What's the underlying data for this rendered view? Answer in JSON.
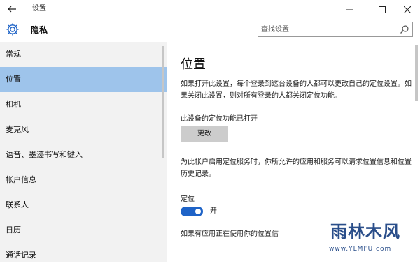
{
  "titlebar": {
    "back_icon": "back-arrow-icon",
    "title": "设置",
    "minimize_icon": "minimize-icon",
    "maximize_icon": "maximize-icon",
    "close_icon": "close-icon"
  },
  "header": {
    "icon": "gear-icon",
    "title": "隐私",
    "search": {
      "placeholder": "查找设置",
      "icon": "search-icon"
    }
  },
  "sidebar": {
    "active_color": "#9ec4eb",
    "items": [
      {
        "label": "常规",
        "active": false
      },
      {
        "label": "位置",
        "active": true
      },
      {
        "label": "相机",
        "active": false
      },
      {
        "label": "麦克风",
        "active": false
      },
      {
        "label": "语音、墨迹书写和键入",
        "active": false
      },
      {
        "label": "帐户信息",
        "active": false
      },
      {
        "label": "联系人",
        "active": false
      },
      {
        "label": "日历",
        "active": false
      },
      {
        "label": "通话记录",
        "active": false
      }
    ]
  },
  "content": {
    "title": "位置",
    "intro": "如果打开此设置，每个登录到这台设备的人都可以更改自己的定位设置。如果关闭此设置，则对所有登录的人都关闭定位功能。",
    "device_status": "此设备的定位功能已打开",
    "change_button": "更改",
    "account_desc": "为此帐户启用定位服务时，你所允许的应用和服务可以请求位置信息和位置历史记录。",
    "location_label": "定位",
    "toggle": {
      "state": "开",
      "on": true,
      "color": "#1e63c7"
    },
    "app_usage_text": "如果有应用正在使用你的位置信"
  },
  "watermark": {
    "name": "雨林木风",
    "url": "www.YLMFU.com"
  }
}
